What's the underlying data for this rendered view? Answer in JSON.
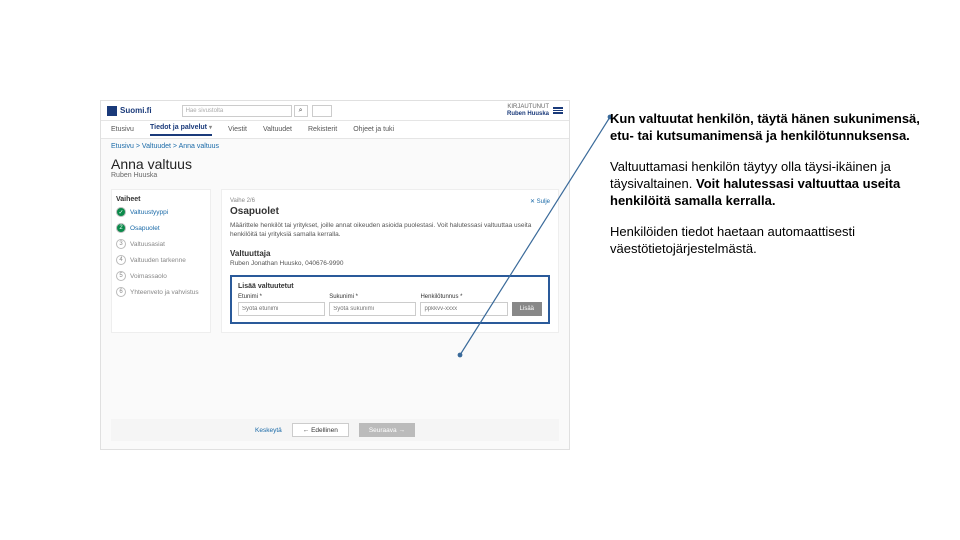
{
  "brand": "Suomi.fi",
  "search": {
    "placeholder": "Hae sivustolta"
  },
  "user": {
    "label": "KIRJAUTUNUT",
    "name": "Ruben Huuska"
  },
  "nav": {
    "items": [
      "Etusivu",
      "Tiedot ja palvelut",
      "Viestit",
      "Valtuudet",
      "Rekisterit",
      "Ohjeet ja tuki"
    ]
  },
  "breadcrumb": "Etusivu > Valtuudet > Anna valtuus",
  "page": {
    "title": "Anna valtuus",
    "subtitle": "Ruben Huuska"
  },
  "steps": {
    "header": "Vaiheet",
    "list": [
      {
        "n": "✓",
        "label": "Valtuustyyppi",
        "state": "done"
      },
      {
        "n": "2",
        "label": "Osapuolet",
        "state": "cur"
      },
      {
        "n": "3",
        "label": "Valtuusasiat",
        "state": "dim"
      },
      {
        "n": "4",
        "label": "Valtuuden tarkenne",
        "state": "dim"
      },
      {
        "n": "5",
        "label": "Voimassaolo",
        "state": "dim"
      },
      {
        "n": "6",
        "label": "Yhteenveto ja vahvistus",
        "state": "dim"
      }
    ]
  },
  "main": {
    "step_ind": "Vaihe 2/6",
    "title": "Osapuolet",
    "close": "✕ Sulje",
    "desc": "Määrittele henkilöt tai yritykset, joille annat oikeuden asioida puolestasi. Voit halutessasi valtuuttaa useita henkilöitä tai yrityksiä samalla kerralla.",
    "valtuuttaja": {
      "title": "Valtuuttaja",
      "value": "Ruben Jonathan Huusko, 040676-9990"
    },
    "highlight": {
      "title": "Lisää valtuutetut",
      "fields": [
        {
          "label": "Etunimi *",
          "placeholder": "Syötä etunimi"
        },
        {
          "label": "Sukunimi *",
          "placeholder": "Syötä sukunimi"
        },
        {
          "label": "Henkilötunnus *",
          "placeholder": "ppkkvv-xxxx"
        }
      ],
      "button": "Lisää"
    }
  },
  "bottom": {
    "cancel": "Keskeytä",
    "prev": "← Edellinen",
    "next": "Seuraava →"
  },
  "annotations": {
    "p1": "Kun valtuutat henkilön, täytä hänen sukunimensä, etu- tai kutsumanimensä ja henkilötunnuksensa.",
    "p2a": "Valtuuttamasi henkilön täytyy olla täysi-ikäinen ja täysivaltainen. ",
    "p2b": "Voit halutessasi valtuuttaa useita henkilöitä samalla kerralla.",
    "p3": "Henkilöiden tiedot haetaan automaattisesti väestötietojärjestelmästä."
  }
}
